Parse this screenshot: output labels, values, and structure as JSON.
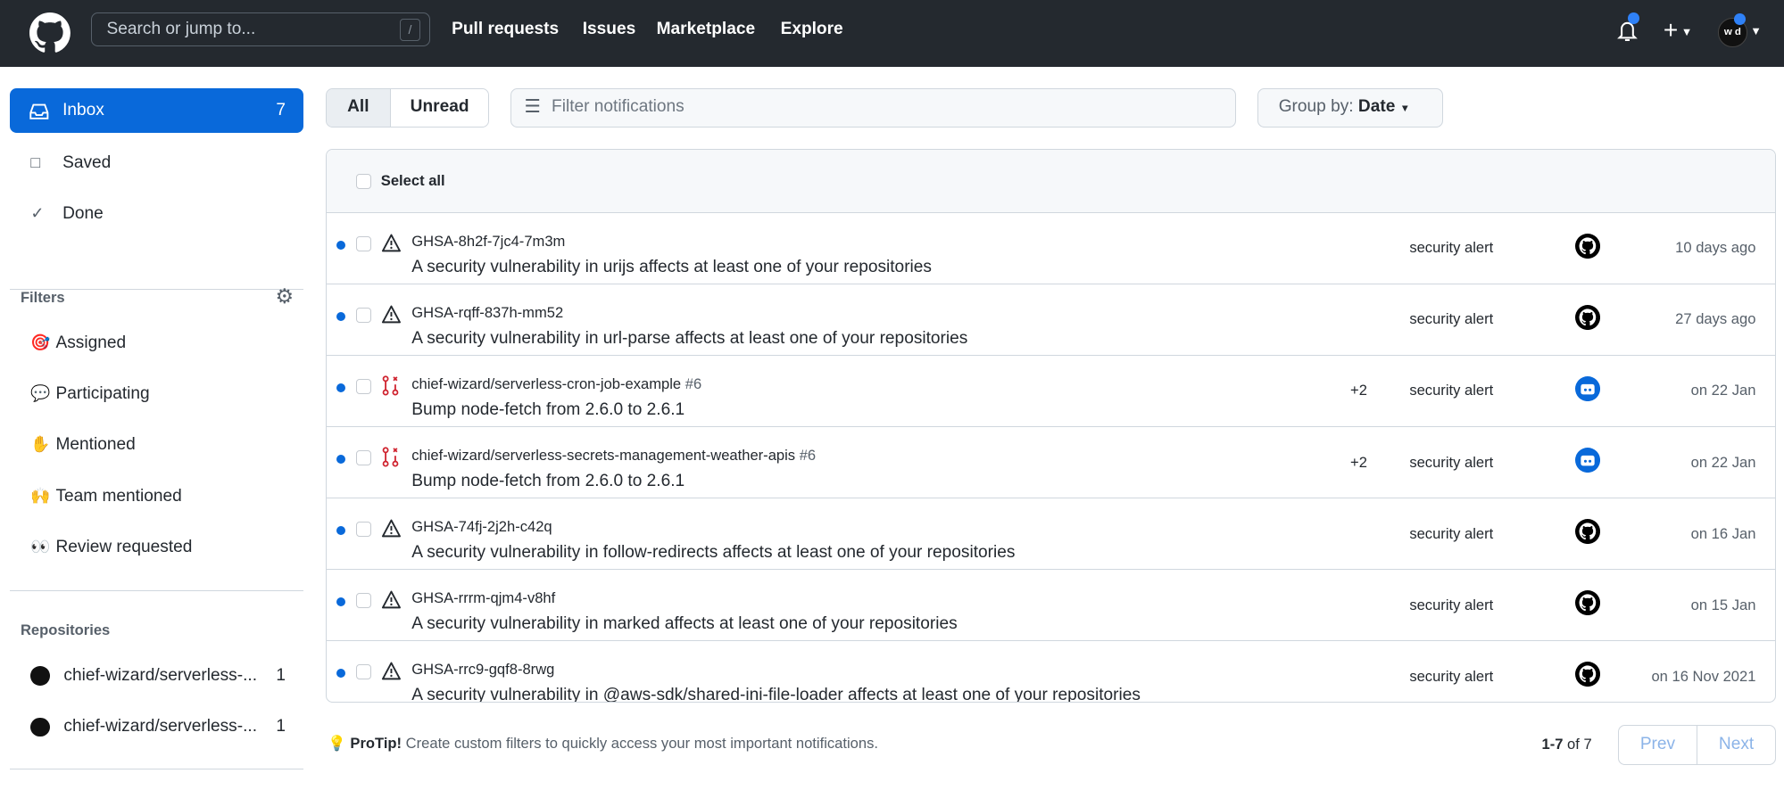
{
  "header": {
    "search_placeholder": "Search or jump to...",
    "search_shortcut": "/",
    "nav": [
      "Pull requests",
      "Issues",
      "Marketplace",
      "Explore"
    ],
    "avatar_initials": "w d"
  },
  "sidebar": {
    "inbox": {
      "label": "Inbox",
      "count": "7"
    },
    "saved": "Saved",
    "done": "Done",
    "filters_label": "Filters",
    "filters": [
      {
        "emoji": "🎯",
        "label": "Assigned"
      },
      {
        "emoji": "💬",
        "label": "Participating"
      },
      {
        "emoji": "✋",
        "label": "Mentioned"
      },
      {
        "emoji": "🙌",
        "label": "Team mentioned"
      },
      {
        "emoji": "👀",
        "label": "Review requested"
      }
    ],
    "repositories_label": "Repositories",
    "repositories": [
      {
        "name": "chief-wizard/serverless-...",
        "count": "1"
      },
      {
        "name": "chief-wizard/serverless-...",
        "count": "1"
      }
    ]
  },
  "toolbar": {
    "all": "All",
    "unread": "Unread",
    "filter_placeholder": "Filter notifications",
    "group_by_label": "Group by:",
    "group_by_value": "Date"
  },
  "list": {
    "select_all": "Select all",
    "rows": [
      {
        "type": "alert",
        "title": "GHSA-8h2f-7jc4-7m3m",
        "num": "",
        "subject": "A security vulnerability in urijs affects at least one of your repositories",
        "plus": "",
        "reason": "security alert",
        "avatar": "github",
        "date": "10 days ago"
      },
      {
        "type": "alert",
        "title": "GHSA-rqff-837h-mm52",
        "num": "",
        "subject": "A security vulnerability in url-parse affects at least one of your repositories",
        "plus": "",
        "reason": "security alert",
        "avatar": "github",
        "date": "27 days ago"
      },
      {
        "type": "pr",
        "title": "chief-wizard/serverless-cron-job-example",
        "num": "#6",
        "subject": "Bump node-fetch from 2.6.0 to 2.6.1",
        "plus": "+2",
        "reason": "security alert",
        "avatar": "bot",
        "date": "on 22 Jan"
      },
      {
        "type": "pr",
        "title": "chief-wizard/serverless-secrets-management-weather-apis",
        "num": "#6",
        "subject": "Bump node-fetch from 2.6.0 to 2.6.1",
        "plus": "+2",
        "reason": "security alert",
        "avatar": "bot",
        "date": "on 22 Jan"
      },
      {
        "type": "alert",
        "title": "GHSA-74fj-2j2h-c42q",
        "num": "",
        "subject": "A security vulnerability in follow-redirects affects at least one of your repositories",
        "plus": "",
        "reason": "security alert",
        "avatar": "github",
        "date": "on 16 Jan"
      },
      {
        "type": "alert",
        "title": "GHSA-rrrm-qjm4-v8hf",
        "num": "",
        "subject": "A security vulnerability in marked affects at least one of your repositories",
        "plus": "",
        "reason": "security alert",
        "avatar": "github",
        "date": "on 15 Jan"
      },
      {
        "type": "alert",
        "title": "GHSA-rrc9-gqf8-8rwg",
        "num": "",
        "subject": "A security vulnerability in @aws-sdk/shared-ini-file-loader affects at least one of your repositories",
        "plus": "",
        "reason": "security alert",
        "avatar": "github",
        "date": "on 16 Nov 2021"
      }
    ]
  },
  "footer": {
    "protip_label": "ProTip!",
    "protip_text": "Create custom filters to quickly access your most important notifications.",
    "range": "1-7",
    "of_total": "of 7",
    "prev": "Prev",
    "next": "Next"
  },
  "colors": {
    "accent": "#0969da",
    "header_bg": "#24292f",
    "pr_closed": "#cf222e"
  }
}
